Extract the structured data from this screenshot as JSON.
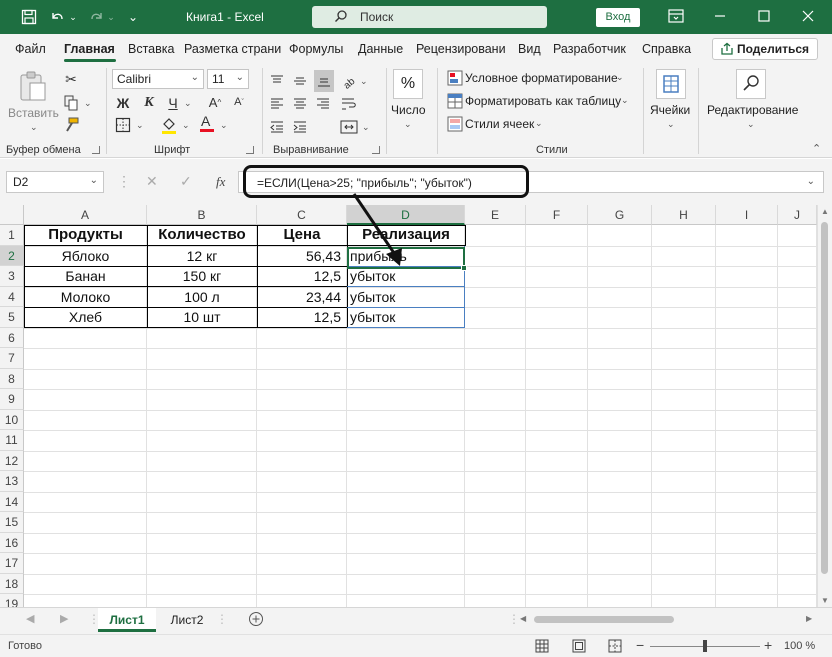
{
  "window": {
    "title": "Книга1  -  Excel",
    "search_placeholder": "Поиск",
    "signin_label": "Вход",
    "accent_color": "#1e6f41"
  },
  "tabs": {
    "items": [
      "Файл",
      "Главная",
      "Вставка",
      "Разметка страни",
      "Формулы",
      "Данные",
      "Рецензировани",
      "Вид",
      "Разработчик",
      "Справка"
    ],
    "active": "Главная",
    "share_label": "Поделиться"
  },
  "ribbon": {
    "clipboard": {
      "paste_label": "Вставить",
      "group_label": "Буфер обмена"
    },
    "font": {
      "font_name": "Calibri",
      "font_size": "11",
      "bold": "Ж",
      "italic": "К",
      "underline": "Ч",
      "group_label": "Шрифт"
    },
    "alignment": {
      "group_label": "Выравнивание"
    },
    "number": {
      "label": "Число",
      "percent": "%"
    },
    "styles": {
      "conditional": "Условное форматирование",
      "format_table": "Форматировать как таблицу",
      "cell_styles": "Стили ячеек",
      "group_label": "Стили"
    },
    "cells": {
      "label": "Ячейки"
    },
    "editing": {
      "label": "Редактирование"
    }
  },
  "formula_bar": {
    "name_box": "D2",
    "fx": "fx",
    "formula": "=ЕСЛИ(Цена>25; \"прибыль\"; \"убыток\")"
  },
  "grid": {
    "columns": [
      "A",
      "B",
      "C",
      "D",
      "E",
      "F",
      "G",
      "H",
      "I",
      "J"
    ],
    "selected_column": "D",
    "row_numbers": [
      "1",
      "2",
      "3",
      "4",
      "5",
      "6",
      "7",
      "8",
      "9",
      "10",
      "11",
      "12",
      "13",
      "14",
      "15",
      "16",
      "17",
      "18",
      "19"
    ],
    "selected_row": "2",
    "selected_cell": "D2",
    "headers": [
      "Продукты",
      "Количество",
      "Цена",
      "Реализация"
    ],
    "rows": [
      [
        "Яблоко",
        "12 кг",
        "56,43",
        "прибыль"
      ],
      [
        "Банан",
        "150 кг",
        "12,5",
        "убыток"
      ],
      [
        "Молоко",
        "100 л",
        "23,44",
        "убыток"
      ],
      [
        "Хлеб",
        "10 шт",
        "12,5",
        "убыток"
      ]
    ]
  },
  "sheets": {
    "tabs": [
      "Лист1",
      "Лист2"
    ],
    "active": "Лист1"
  },
  "status": {
    "text": "Готово",
    "zoom": "100 %"
  }
}
